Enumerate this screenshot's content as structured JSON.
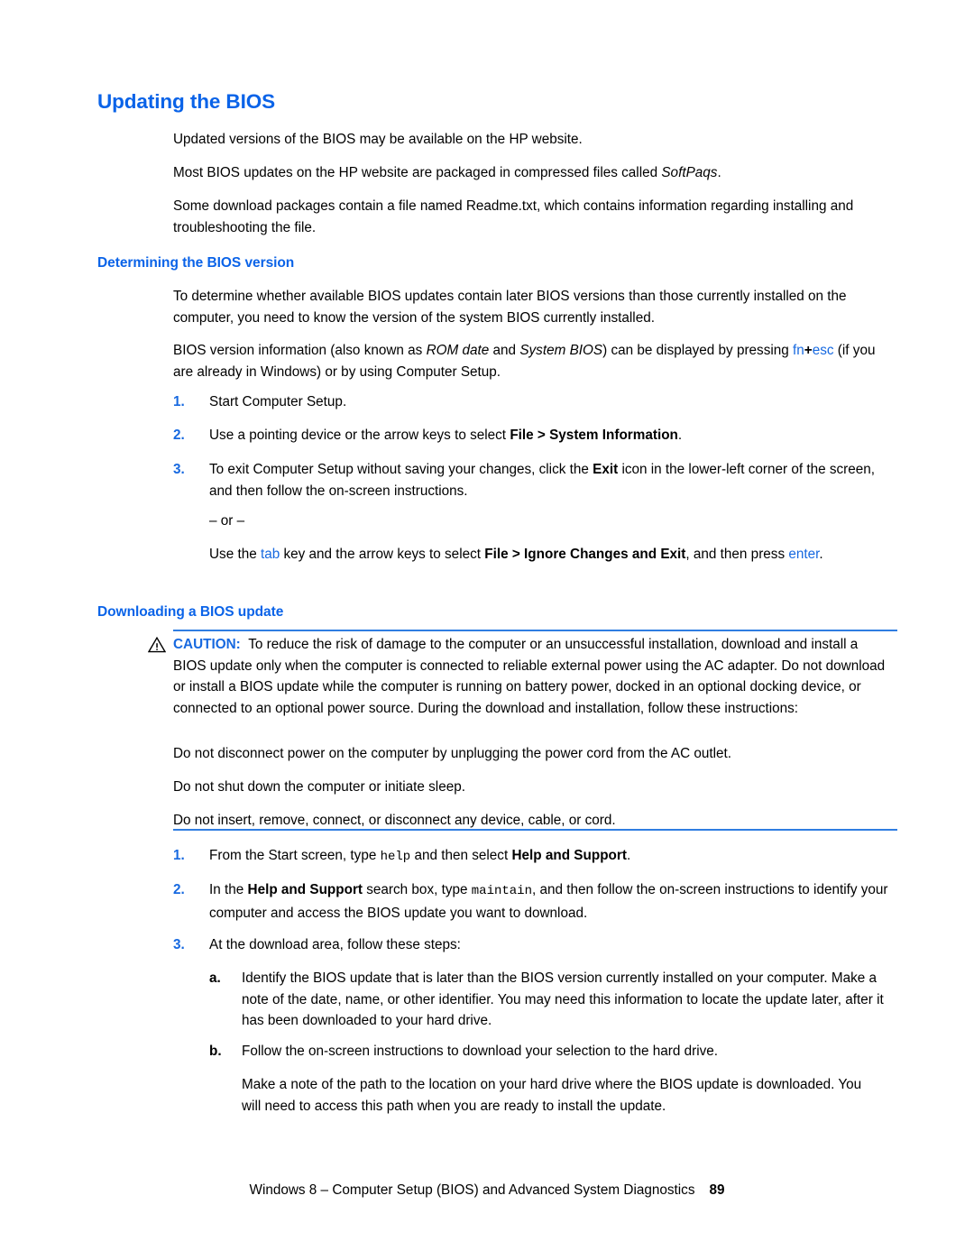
{
  "document": {
    "title": "Updating the BIOS",
    "colors": {
      "heading_blue": "#0a63e8",
      "link_blue": "#1769e0",
      "rule_blue": "#2f7de1",
      "body_black": "#000000"
    }
  },
  "section_intro": {
    "p1": "Updated versions of the BIOS may be available on the HP website.",
    "p2_prefix": "Most BIOS updates on the HP website are packaged in compressed files called ",
    "p2_italic": "SoftPaqs",
    "p2_suffix": ".",
    "p3": "Some download packages contain a file named Readme.txt, which contains information regarding installing and troubleshooting the file."
  },
  "section_determining": {
    "heading": "Determining the BIOS version",
    "p1": "To determine whether available BIOS updates contain later BIOS versions than those currently installed on the computer, you need to know the version of the system BIOS currently installed.",
    "p2_a": "BIOS version information (also known as ",
    "p2_italic1": "ROM date",
    "p2_b": " and ",
    "p2_italic2": "System BIOS",
    "p2_c": ") can be displayed by pressing ",
    "p2_key1": "fn",
    "p2_plus": "+",
    "p2_key2": "esc",
    "p2_d": " (if you are already in Windows) or by using Computer Setup.",
    "steps": [
      {
        "marker": "1.",
        "text": "Start Computer Setup."
      },
      {
        "marker": "2.",
        "prefix": "Use a pointing device or the arrow keys to select ",
        "bold": "File > System Information",
        "suffix": "."
      },
      {
        "marker": "3.",
        "prefix": "To exit Computer Setup without saving your changes, click the ",
        "bold": "Exit",
        "suffix": " icon in the lower-left corner of the screen, and then follow the on-screen instructions."
      }
    ],
    "or_separator": "– or –",
    "alt_a": "Use the ",
    "alt_key1": "tab",
    "alt_b": " key and the arrow keys to select ",
    "alt_bold": "File > Ignore Changes and Exit",
    "alt_c": ", and then press ",
    "alt_key2": "enter",
    "alt_d": "."
  },
  "section_downloading": {
    "heading": "Downloading a BIOS update",
    "caution": {
      "icon": "warning-triangle-icon",
      "label": "CAUTION:",
      "text": "To reduce the risk of damage to the computer or an unsuccessful installation, download and install a BIOS update only when the computer is connected to reliable external power using the AC adapter. Do not download or install a BIOS update while the computer is running on battery power, docked in an optional docking device, or connected to an optional power source. During the download and installation, follow these instructions:",
      "items": [
        "Do not disconnect power on the computer by unplugging the power cord from the AC outlet.",
        "Do not shut down the computer or initiate sleep.",
        "Do not insert, remove, connect, or disconnect any device, cable, or cord."
      ]
    },
    "steps": [
      {
        "marker": "1.",
        "a": "From the Start screen, type ",
        "mono": "help",
        "b": " and then select ",
        "bold": "Help and Support",
        "c": "."
      },
      {
        "marker": "2.",
        "a": "In the ",
        "bold": "Help and Support",
        "b": " search box, type ",
        "mono": "maintain",
        "c": ", and then follow the on-screen instructions to identify your computer and access the BIOS update you want to download."
      },
      {
        "marker": "3.",
        "a": "At the download area, follow these steps:"
      }
    ],
    "substeps": [
      {
        "marker": "a.",
        "text": "Identify the BIOS update that is later than the BIOS version currently installed on your computer. Make a note of the date, name, or other identifier. You may need this information to locate the update later, after it has been downloaded to your hard drive."
      },
      {
        "marker": "b.",
        "text": "Follow the on-screen instructions to download your selection to the hard drive."
      }
    ],
    "final_note": "Make a note of the path to the location on your hard drive where the BIOS update is downloaded. You will need to access this path when you are ready to install the update."
  },
  "footer": {
    "text": "Windows 8 – Computer Setup (BIOS) and Advanced System Diagnostics",
    "page_number": "89"
  }
}
